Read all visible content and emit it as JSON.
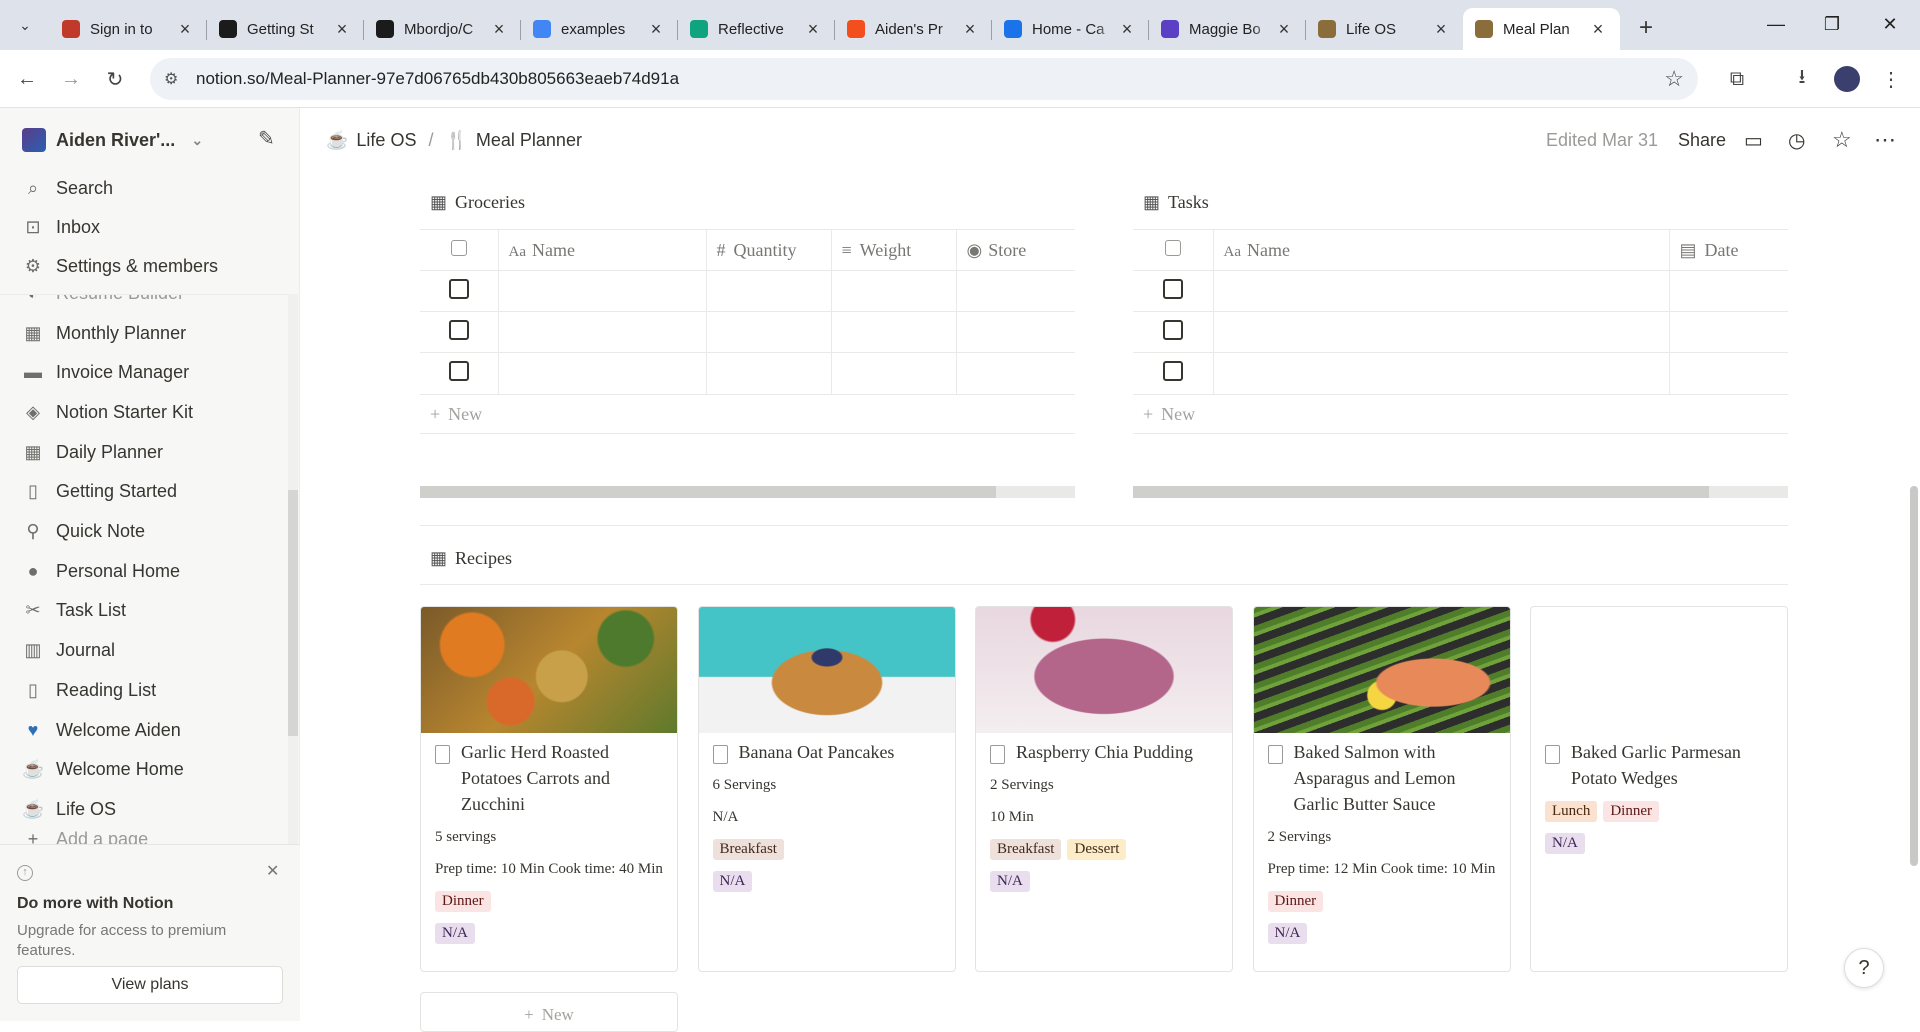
{
  "browser": {
    "tabs": [
      {
        "title": "Sign in to",
        "color": "#c0392b"
      },
      {
        "title": "Getting St",
        "color": "#1b1b1b"
      },
      {
        "title": "Mbordjo/C",
        "color": "#1b1b1b"
      },
      {
        "title": "examples",
        "color": "#4285f4"
      },
      {
        "title": "Reflective",
        "color": "#10a37f"
      },
      {
        "title": "Aiden's Pr",
        "color": "#f24e1e"
      },
      {
        "title": "Home - Ca",
        "color": "#1a73e8"
      },
      {
        "title": "Maggie Bo",
        "color": "#5b3fc4"
      },
      {
        "title": "Life OS",
        "color": "#8a6d3b"
      },
      {
        "title": "Meal Plan",
        "color": "#8a6d3b"
      }
    ],
    "url": "notion.so/Meal-Planner-97e7d06765db430b805663eaeb74d91a"
  },
  "sidebar": {
    "workspace": "Aiden River'...",
    "top": [
      {
        "label": "Search",
        "icon": "search-icon"
      },
      {
        "label": "Inbox",
        "icon": "inbox-icon"
      },
      {
        "label": "Settings & members",
        "icon": "gear-icon"
      }
    ],
    "partial_top": "Resume Builder",
    "pages": [
      {
        "label": "Monthly Planner",
        "icon": "calendar-icon"
      },
      {
        "label": "Invoice Manager",
        "icon": "folder-icon"
      },
      {
        "label": "Notion Starter Kit",
        "icon": "shapes-icon"
      },
      {
        "label": "Daily Planner",
        "icon": "calendar-icon"
      },
      {
        "label": "Getting Started",
        "icon": "document-icon"
      },
      {
        "label": "Quick Note",
        "icon": "pin-icon"
      },
      {
        "label": "Personal Home",
        "icon": "person-icon"
      },
      {
        "label": "Task List",
        "icon": "scissors-icon"
      },
      {
        "label": "Journal",
        "icon": "book-icon"
      },
      {
        "label": "Reading List",
        "icon": "document-icon"
      },
      {
        "label": "Welcome Aiden",
        "icon": "heart-icon"
      },
      {
        "label": "Welcome Home",
        "icon": "coffee-icon"
      },
      {
        "label": "Life OS",
        "icon": "coffee-icon"
      }
    ],
    "add_page": "Add a page",
    "upsell": {
      "heading": "Do more with Notion",
      "description": "Upgrade for access to premium features.",
      "button": "View plans"
    }
  },
  "topbar": {
    "crumb_parent": "Life OS",
    "crumb_current": "Meal Planner",
    "edited": "Edited Mar 31",
    "share": "Share"
  },
  "groceries": {
    "title": "Groceries",
    "columns": [
      "Name",
      "Quantity",
      "Weight",
      "Store"
    ],
    "new_label": "New",
    "scroll_fraction": 0.88
  },
  "tasks": {
    "title": "Tasks",
    "columns": [
      "Name",
      "Date"
    ],
    "new_label": "New",
    "scroll_fraction": 0.88
  },
  "recipes": {
    "title": "Recipes",
    "new_label": "New",
    "cards": [
      {
        "title": "Garlic Herd Roasted Potatoes Carrots and Zucchini",
        "props": [
          "5 servings",
          "Prep time: 10 Min Cook time: 40 Min"
        ],
        "tags": [
          "Dinner"
        ],
        "extra": "N/A",
        "image": "roast"
      },
      {
        "title": "Banana Oat Pancakes",
        "props": [
          "6 Servings",
          "N/A"
        ],
        "tags": [
          "Breakfast"
        ],
        "extra": "N/A",
        "image": "pancake"
      },
      {
        "title": "Raspberry Chia Pudding",
        "props": [
          "2 Servings",
          "10 Min"
        ],
        "tags": [
          "Breakfast",
          "Dessert"
        ],
        "extra": "N/A",
        "image": "pudding"
      },
      {
        "title": "Baked Salmon with Asparagus and Lemon Garlic Butter Sauce",
        "props": [
          "2 Servings",
          "Prep time: 12 Min Cook time: 10 Min"
        ],
        "tags": [
          "Dinner"
        ],
        "extra": "N/A",
        "image": "salmon"
      },
      {
        "title": "Baked Garlic Parmesan Potato Wedges",
        "props": [],
        "tags": [
          "Lunch",
          "Dinner"
        ],
        "extra": "N/A",
        "image": "none"
      }
    ]
  },
  "help": "?"
}
